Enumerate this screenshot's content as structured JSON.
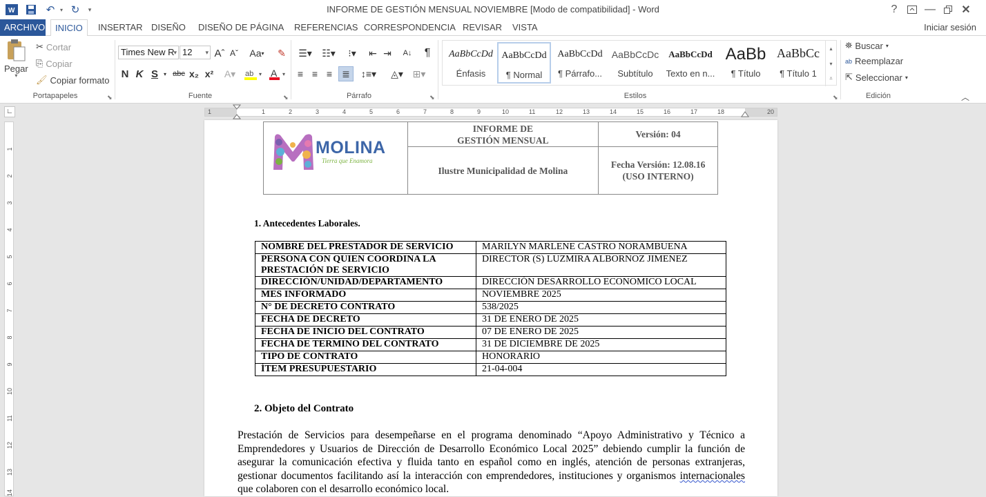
{
  "window": {
    "title": "INFORME DE GESTIÓN MENSUAL NOVIEMBRE [Modo de compatibilidad] - Word",
    "help_label": "?",
    "signin_label": "Iniciar sesión"
  },
  "tabs": [
    {
      "label": "ARCHIVO"
    },
    {
      "label": "INICIO"
    },
    {
      "label": "INSERTAR"
    },
    {
      "label": "DISEÑO"
    },
    {
      "label": "DISEÑO DE PÁGINA"
    },
    {
      "label": "REFERENCIAS"
    },
    {
      "label": "CORRESPONDENCIA"
    },
    {
      "label": "REVISAR"
    },
    {
      "label": "VISTA"
    }
  ],
  "ribbon": {
    "clipboard": {
      "paste_label": "Pegar",
      "cut_label": "Cortar",
      "copy_label": "Copiar",
      "format_painter_label": "Copiar formato",
      "group_label": "Portapapeles"
    },
    "font": {
      "font_name": "Times New R",
      "font_size": "12",
      "bold": "N",
      "italic": "K",
      "underline": "S",
      "strikethrough": "abc",
      "subscript": "x₂",
      "superscript": "x²",
      "change_case": "Aa",
      "group_label": "Fuente"
    },
    "paragraph": {
      "group_label": "Párrafo"
    },
    "styles": {
      "items": [
        {
          "sample": "AaBbCcDd",
          "name": "Énfasis"
        },
        {
          "sample": "AaBbCcDd",
          "name": "¶ Normal"
        },
        {
          "sample": "AaBbCcDd",
          "name": "¶ Párrafo..."
        },
        {
          "sample": "AaBbCcDc",
          "name": "Subtítulo"
        },
        {
          "sample": "AaBbCcDd",
          "name": "Texto en n..."
        },
        {
          "sample": "AaBb",
          "name": "¶ Título"
        },
        {
          "sample": "AaBbCc",
          "name": "¶ Título 1"
        }
      ],
      "group_label": "Estilos"
    },
    "editing": {
      "find_label": "Buscar",
      "replace_label": "Reemplazar",
      "select_label": "Seleccionar",
      "group_label": "Edición"
    }
  },
  "ruler": {
    "numbers": [
      "1",
      "1",
      "2",
      "3",
      "4",
      "5",
      "6",
      "7",
      "8",
      "9",
      "10",
      "11",
      "12",
      "13",
      "14",
      "15",
      "16",
      "17",
      "18",
      "20"
    ],
    "vertical_numbers": [
      "1",
      "2",
      "3",
      "4",
      "5",
      "6",
      "7",
      "8",
      "9",
      "10",
      "11",
      "12",
      "13",
      "14"
    ]
  },
  "document": {
    "header": {
      "logo_text": "MOLINA",
      "logo_tagline": "Tierra que Enamora",
      "report_title_line1": "INFORME DE",
      "report_title_line2": "GESTIÓN MENSUAL",
      "version": "Versión: 04",
      "organization": "Ilustre Municipalidad de Molina",
      "version_date_line1": "Fecha Versión: 12.08.16",
      "version_date_line2": "(USO INTERNO)"
    },
    "section1_title": "1.   Antecedentes Laborales.",
    "info_rows": [
      {
        "key": "NOMBRE DEL PRESTADOR DE SERVICIO",
        "value": "MARILYN MARLENE CASTRO NORAMBUENA"
      },
      {
        "key": "PERSONA CON QUIEN COORDINA LA PRESTACIÓN DE SERVICIO",
        "value": "DIRECTOR (S) LUZMIRA ALBORNOZ JIMENEZ"
      },
      {
        "key": "DIRECCIÓN/UNIDAD/DEPARTAMENTO",
        "value": "DIRECCIÓN DESARROLLO ECONOMICO LOCAL"
      },
      {
        "key": "MES INFORMADO",
        "value": "NOVIEMBRE 2025"
      },
      {
        "key": "N° DE DECRETO CONTRATO",
        "value": "538/2025"
      },
      {
        "key": "FECHA DE DECRETO",
        "value": "31 DE ENERO DE 2025"
      },
      {
        "key": "FECHA DE INICIO DEL CONTRATO",
        "value": "07 DE ENERO DE 2025"
      },
      {
        "key": "FECHA DE TERMINO DEL CONTRATO",
        "value": "31 DE DICIEMBRE DE 2025"
      },
      {
        "key": "TIPO DE CONTRATO",
        "value": "HONORARIO"
      },
      {
        "key": "ÍTEM PRESUPUESTARIO",
        "value": "21-04-004"
      }
    ],
    "section2_title": "2.   Objeto del Contrato",
    "paragraph_main": "Prestación de Servicios para desempeñarse en el programa denominado “Apoyo Administrativo y Técnico a Emprendedores y Usuarios de Dirección de Desarrollo Económico Local 2025” debiendo cumplir la función de asegurar la comunicación efectiva y fluida tanto en español como en inglés, atención de personas extranjeras, gestionar documentos facilitando así la interacción con emprendedores, instituciones y organismos",
    "paragraph_underlined": "internacionales",
    "paragraph_end": " que colaboren con el desarrollo económico local."
  }
}
